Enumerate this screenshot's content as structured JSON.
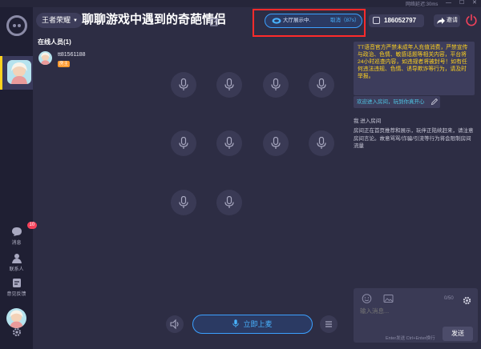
{
  "window": {
    "title_text": "网络延迟:30ms",
    "minimize": "—",
    "maximize": "☐",
    "close": "✕"
  },
  "sidebar": {
    "messages": {
      "label": "消息",
      "badge": "10"
    },
    "contacts": {
      "label": "联系人"
    },
    "feedback": {
      "label": "意见反馈"
    }
  },
  "header": {
    "category": "王者荣耀",
    "room_title": "聊聊游戏中遇到的奇葩情侣",
    "showing": {
      "text": "大厅展示中.",
      "cancel": "取消（87s）"
    },
    "room_id": "186052797",
    "invite": "邀请"
  },
  "members": {
    "title": "在线人员(1)",
    "list": [
      {
        "name": "tt81561188",
        "role": "房主"
      }
    ]
  },
  "main": {
    "go_mic": "立即上麦"
  },
  "chat": {
    "notice": "TT语音官方严禁未成年人充值消费，严禁宣传与政治、色情、敏感话题等相关内容，平台将24小时巡查内容，如违规者将被封号！如有任何违法违规、色情、诱导欺诈等行为，请及时举报。",
    "welcome": "欢迎进入房间，玩到你真开心",
    "msg1": "我 进入房间",
    "msg2": "房间正在首页推荐和展示，玩伴正陆续赶来，请注意房间言论。故意骂骂/诈骗/引流等行为将会限制房间流量"
  },
  "input": {
    "counter": "0/50",
    "placeholder": "输入消息...",
    "hint": "Enter发送 Ctrl+Enter换行",
    "send": "发送"
  },
  "colors": {
    "accent_blue": "#48b3ff",
    "notice_yellow": "#ffd21f",
    "highlight_red": "#ff2b2b",
    "badge_red": "#f5425b",
    "role_orange": "#ff9a2e"
  }
}
